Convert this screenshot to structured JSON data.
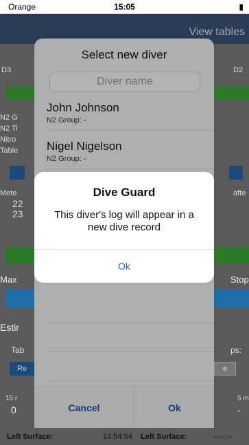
{
  "status": {
    "carrier": "Orange",
    "time": "15:05",
    "bluetooth": "✱"
  },
  "navbar": {
    "right_action": "View tables"
  },
  "background": {
    "left_tag": "D3",
    "right_tag": "D2",
    "left_labels": [
      "N2 G",
      "N2 Ti",
      "Nitro",
      "Table"
    ],
    "mete_label": "Mete",
    "mete_values": [
      "22",
      "23"
    ],
    "after_label": "afte",
    "max_label": "Max",
    "stop_label": "Stop",
    "estimate_label": "Estir",
    "tab_label": "Tab",
    "re_label": "Re",
    "ps_label": "ps:",
    "e_label": "e",
    "left_m": "15 r",
    "left_zero": "0",
    "right_m": "5 m",
    "right_dash": "-"
  },
  "sheet": {
    "title": "Select new diver",
    "search_placeholder": "Diver name",
    "divers": [
      {
        "name": "John Johnson",
        "group": "N2 Group: -"
      },
      {
        "name": "Nigel Nigelson",
        "group": "N2 Group: -"
      }
    ],
    "cancel_label": "Cancel",
    "ok_label": "Ok"
  },
  "alert": {
    "title": "Dive Guard",
    "message": "This diver's log will appear in a new dive record",
    "ok_label": "Ok"
  },
  "bottom": {
    "left_surface_label": "Left Surface:",
    "left_surface_value": "14:54:54",
    "right_surface_label": "Left Surface:",
    "right_surface_value": "--:--:--"
  }
}
